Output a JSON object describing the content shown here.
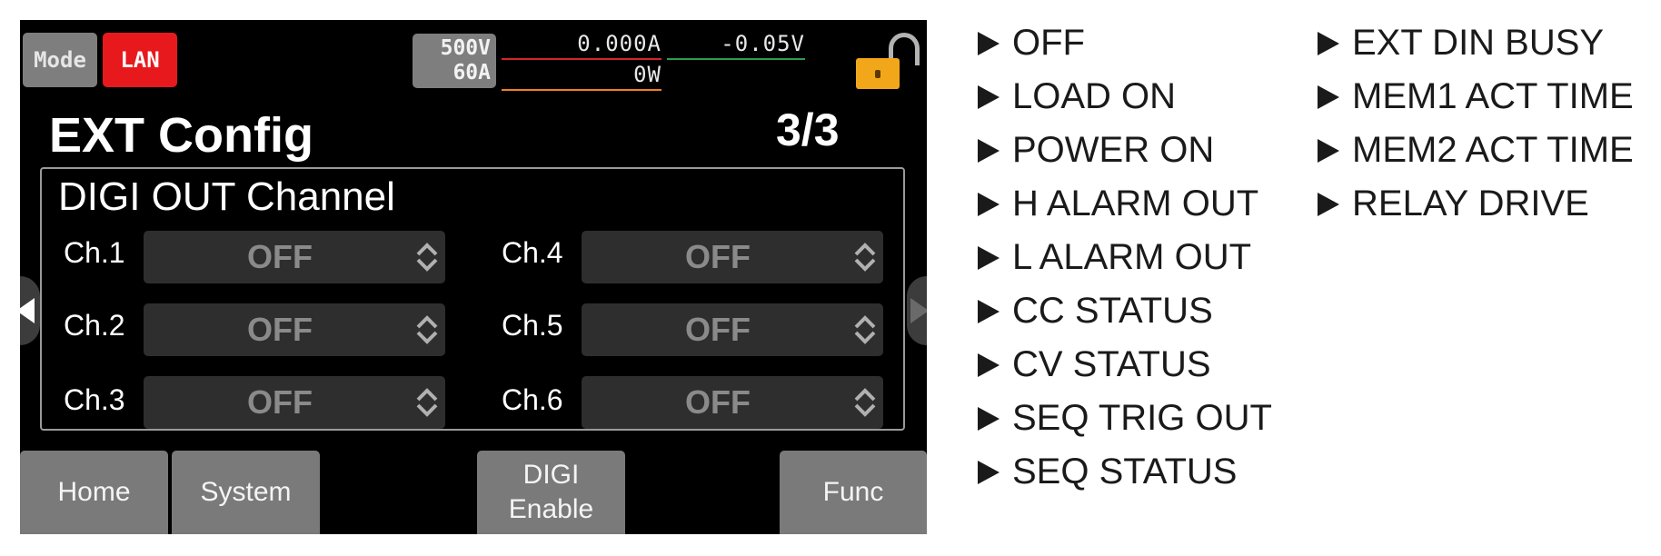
{
  "status_bar": {
    "mode_label": "Mode",
    "lan_label": "LAN",
    "voltage_range": "500V",
    "current_range": "60A",
    "current_reading": "0.000A",
    "voltage_reading": "-0.05V",
    "power_reading": "0W"
  },
  "page": {
    "title": "EXT Config",
    "counter": "3/3"
  },
  "panel": {
    "title": "DIGI OUT Channel",
    "channels": [
      {
        "label": "Ch.1",
        "value": "OFF"
      },
      {
        "label": "Ch.2",
        "value": "OFF"
      },
      {
        "label": "Ch.3",
        "value": "OFF"
      },
      {
        "label": "Ch.4",
        "value": "OFF"
      },
      {
        "label": "Ch.5",
        "value": "OFF"
      },
      {
        "label": "Ch.6",
        "value": "OFF"
      }
    ]
  },
  "softkeys": {
    "home": "Home",
    "system": "System",
    "digi_line1": "DIGI",
    "digi_line2": "Enable",
    "func": "Func"
  },
  "legend": {
    "options_col1": [
      "OFF",
      "LOAD ON",
      "POWER ON",
      "H ALARM OUT",
      "L ALARM OUT",
      "CC STATUS",
      "CV STATUS",
      "SEQ TRIG OUT",
      "SEQ STATUS"
    ],
    "options_col2": [
      "EXT DIN BUSY",
      "MEM1 ACT TIME",
      "MEM2 ACT TIME",
      "RELAY DRIVE"
    ]
  },
  "colors": {
    "lan_active": "#e8191c",
    "current_underline": "#d5252a",
    "voltage_underline": "#2d9a52",
    "power_underline": "#ee7f22",
    "lock_icon": "#f2a71b"
  }
}
